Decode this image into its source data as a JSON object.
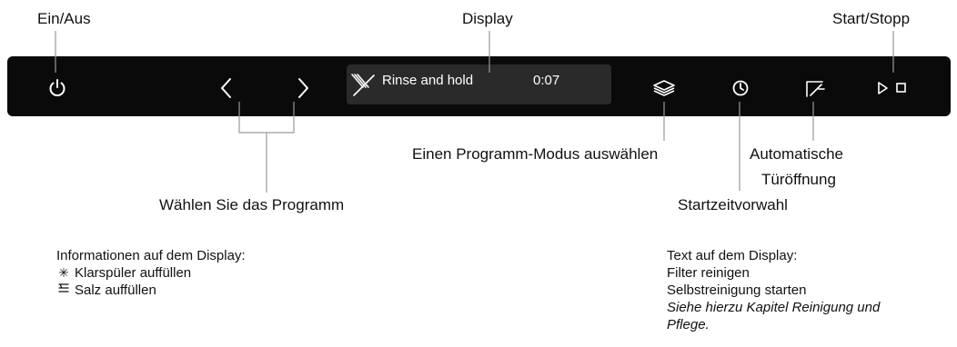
{
  "labels": {
    "power": "Ein/Aus",
    "display": "Display",
    "start_stop": "Start/Stopp",
    "program_select": "Wählen Sie das Programm",
    "program_mode": "Einen Programm-Modus auswählen",
    "auto_door_line1": "Automatische",
    "auto_door_line2": "Türöffnung",
    "delay_start": "Startzeitvorwahl"
  },
  "display": {
    "program": "Rinse and hold",
    "time": "0:07"
  },
  "info_left": {
    "heading": "Informationen auf dem Display:",
    "items": [
      {
        "icon": "rinse-aid-icon",
        "text": "Klarspüler auffüllen"
      },
      {
        "icon": "salt-icon",
        "text": "Salz auffüllen"
      }
    ]
  },
  "info_right": {
    "heading": "Text auf dem Display:",
    "lines": [
      "Filter reinigen",
      "Selbstreinigung starten"
    ],
    "note_line1": "Siehe hierzu Kapitel Reinigung und",
    "note_line2": "Pflege."
  },
  "colors": {
    "panel": "#0a0a0a",
    "display": "#2a2a2a",
    "icon": "#ffffff",
    "leader": "#9a9a9a"
  }
}
